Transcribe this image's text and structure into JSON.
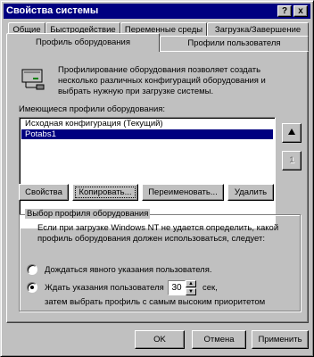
{
  "window": {
    "title": "Свойства системы"
  },
  "titlebar_buttons": {
    "help": "?",
    "close": "x"
  },
  "tabs_row1": [
    "Общие",
    "Быстродействие",
    "Переменные среды",
    "Загрузка/Завершение"
  ],
  "tabs_row2": [
    "Профиль оборудования",
    "Профили пользователя"
  ],
  "panel": {
    "description": "Профилирование оборудования позволяет создать несколько различных конфигураций оборудования и выбрать нужную при загрузке системы.",
    "list_label": "Имеющиеся профили оборудования:",
    "profiles": [
      "Исходная конфигурация (Текущий)",
      "Potabs1"
    ],
    "buttons": {
      "properties": "Свойства",
      "copy": "Копировать...",
      "rename": "Переименовать...",
      "delete": "Удалить"
    },
    "move_up": "↑",
    "move_down": "1",
    "group": {
      "legend": "Выбор профиля оборудования",
      "text": "Если при загрузке Windows NT не удается определить, какой профиль оборудования должен использоваться, следует:",
      "option_wait": "Дождаться явного указания пользователя.",
      "option_timeout": "Ждать указания пользователя",
      "timeout_value": "30",
      "seconds_label": "сек,",
      "timeout_note": "затем выбрать профиль с самым высоким приоритетом"
    }
  },
  "footer": {
    "ok": "OK",
    "cancel": "Отмена",
    "apply": "Применить"
  }
}
